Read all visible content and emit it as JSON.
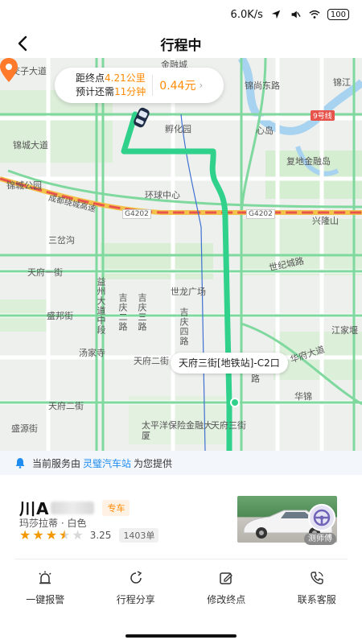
{
  "status_bar": {
    "speed": "6.0K/s",
    "battery": "100"
  },
  "header": {
    "title": "行程中"
  },
  "trip": {
    "distance_prefix": "距终点",
    "distance_value": "4.21公里",
    "eta_prefix": "预计还需",
    "eta_value": "11分钟",
    "fare": "0.44元"
  },
  "map": {
    "labels": {
      "jiaozi": "交子大道",
      "jincheng": "锦城大道",
      "jinhui": "金融城",
      "jinhui_e": "锦尚东路",
      "jinjiang": "锦江",
      "line9": "9号线",
      "fuhua": "孵化园",
      "xindao": "心岛",
      "fudi": "复地金融岛",
      "park": "锦城公园",
      "chengdu_ring": "成都绕城高速",
      "global": "环球中心",
      "g4202_a": "G4202",
      "g4202_b": "G4202",
      "xinglong": "兴隆山",
      "sanchagou": "三岔沟",
      "tianfu1": "天府一街",
      "century_city": "世纪城路",
      "shilong": "世龙广场",
      "yizhou": "益州大道中段",
      "jiqing2": "吉庆二路",
      "jiqing3": "吉庆三路",
      "jiqing4": "吉庆四路",
      "shengbang": "盛邦街",
      "tangjiasi": "汤家寺",
      "tianfu2": "天府二街",
      "tianfu3": "天府三街",
      "shengyuan": "盛源街",
      "taiping": "太平洋保险金融大厦",
      "jiangjia": "江家堰",
      "huafu": "华府大道",
      "huajin": "华锦",
      "lu": "路"
    },
    "destination_label": "天府三街[地铁站]-C2口"
  },
  "notice": {
    "prefix": "当前服务由",
    "company": "灵璧汽车站",
    "suffix": "为您提供"
  },
  "driver": {
    "plate": "川A",
    "tag": "专车",
    "car_desc": "玛莎拉蒂 · 白色",
    "rating": "3.25",
    "rating_value": 3.25,
    "orders": "1403单",
    "name": "测师傅"
  },
  "actions": [
    {
      "label": "一键报警",
      "icon": "alarm-icon"
    },
    {
      "label": "行程分享",
      "icon": "share-icon"
    },
    {
      "label": "修改终点",
      "icon": "edit-icon"
    },
    {
      "label": "联系客服",
      "icon": "phone-icon"
    }
  ],
  "colors": {
    "route": "#2fd18b",
    "accent": "#ff8a00",
    "link": "#1e8cf0",
    "star": "#f39800"
  }
}
